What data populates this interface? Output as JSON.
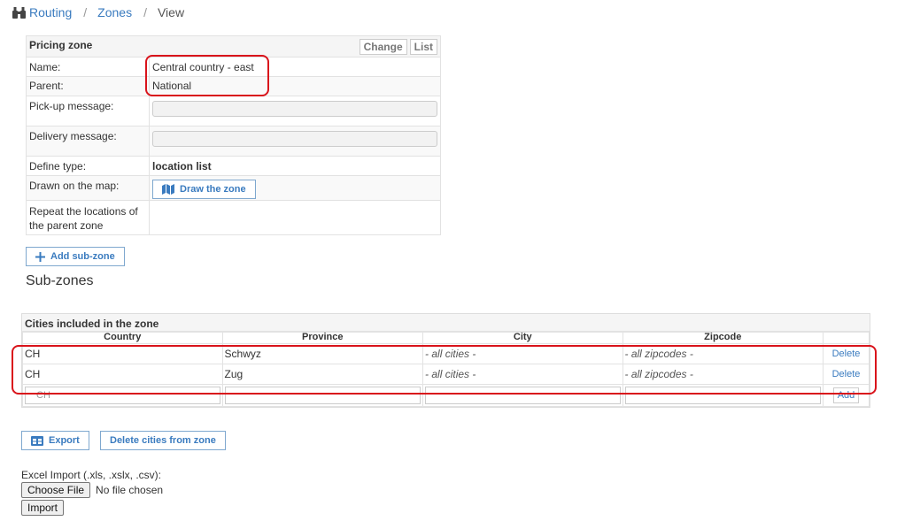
{
  "breadcrumb": {
    "items": [
      "Routing",
      "Zones",
      "View"
    ]
  },
  "pricing_zone": {
    "title": "Pricing zone",
    "change_label": "Change",
    "list_label": "List",
    "rows": [
      {
        "label": "Name:",
        "value": "Central country - east"
      },
      {
        "label": "Parent:",
        "value": "National"
      },
      {
        "label": "Pick-up message:",
        "value": ""
      },
      {
        "label": "Delivery message:",
        "value": ""
      },
      {
        "label": "Define type:",
        "value": "location list"
      },
      {
        "label": "Drawn on the map:",
        "button": "Draw the zone"
      },
      {
        "label": "Repeat the locations of the parent zone",
        "value": ""
      }
    ]
  },
  "add_subzone_label": "Add sub-zone",
  "subzones_title": "Sub-zones",
  "cities": {
    "title": "Cities included in the zone",
    "columns": [
      "Country",
      "Province",
      "City",
      "Zipcode"
    ],
    "rows": [
      {
        "country": "CH",
        "province": "Schwyz",
        "city": "- all cities -",
        "zipcode": "- all zipcodes -",
        "action": "Delete"
      },
      {
        "country": "CH",
        "province": "Zug",
        "city": "- all cities -",
        "zipcode": "- all zipcodes -",
        "action": "Delete"
      }
    ],
    "new_row": {
      "country_placeholder": "CH",
      "add_label": "Add"
    }
  },
  "export_label": "Export",
  "delete_cities_label": "Delete cities from zone",
  "import": {
    "label": "Excel Import (.xls, .xslx, .csv):",
    "choose_file": "Choose File",
    "no_file": "No file chosen",
    "import_button": "Import"
  },
  "colors": {
    "accent": "#3a7bbf",
    "highlight": "#d9131b"
  }
}
